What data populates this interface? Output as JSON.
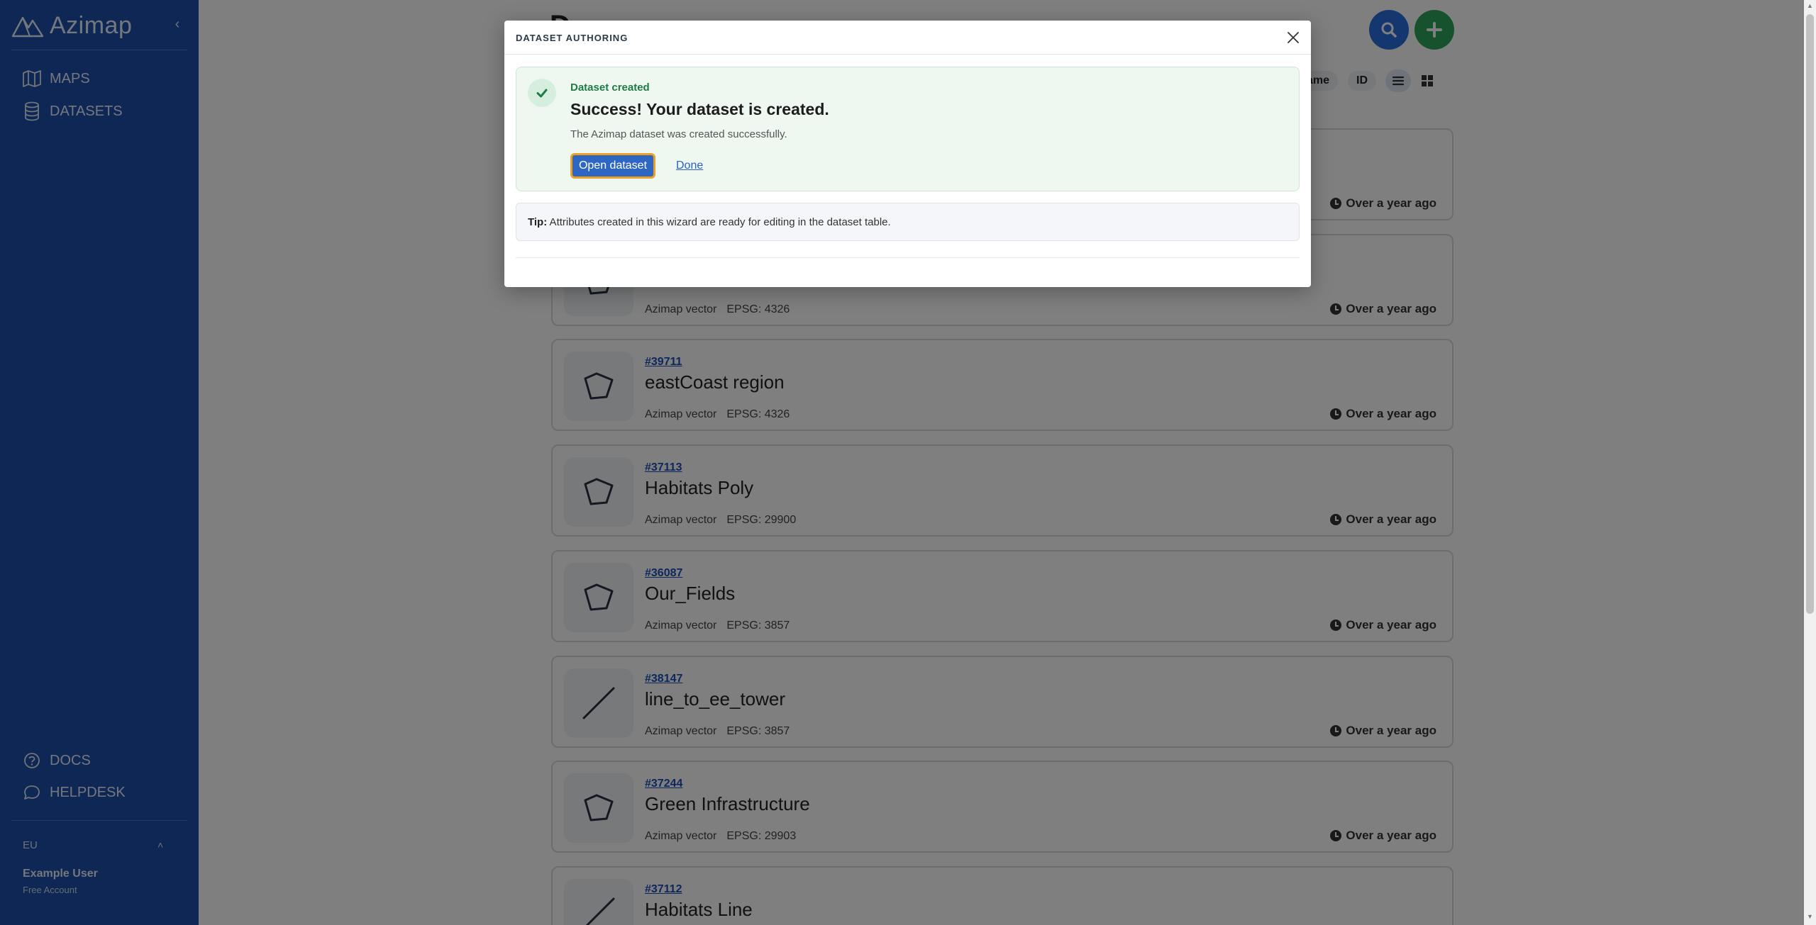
{
  "sidebar": {
    "brand": "Azimap",
    "nav": [
      {
        "label": "MAPS",
        "icon": "map-icon"
      },
      {
        "label": "DATASETS",
        "icon": "database-icon"
      }
    ],
    "bottom_nav": [
      {
        "label": "DOCS",
        "icon": "help-circle-icon"
      },
      {
        "label": "HELPDESK",
        "icon": "chat-bubble-icon"
      }
    ],
    "region": "EU",
    "user_name": "Example User",
    "user_plan": "Free Account"
  },
  "main": {
    "page_title": "D",
    "sort_name_label": "ame",
    "sort_id_label": "ID",
    "datasets": [
      {
        "id": "",
        "name": "",
        "type": "",
        "epsg": "",
        "age": "Over a year ago",
        "geometry": "polygon"
      },
      {
        "id": "",
        "name": "",
        "type": "Azimap vector",
        "epsg": "EPSG: 4326",
        "age": "Over a year ago",
        "geometry": "polygon"
      },
      {
        "id": "#39711",
        "name": "eastCoast region",
        "type": "Azimap vector",
        "epsg": "EPSG: 4326",
        "age": "Over a year ago",
        "geometry": "polygon"
      },
      {
        "id": "#37113",
        "name": "Habitats Poly",
        "type": "Azimap vector",
        "epsg": "EPSG: 29900",
        "age": "Over a year ago",
        "geometry": "polygon"
      },
      {
        "id": "#36087",
        "name": "Our_Fields",
        "type": "Azimap vector",
        "epsg": "EPSG: 3857",
        "age": "Over a year ago",
        "geometry": "polygon"
      },
      {
        "id": "#38147",
        "name": "line_to_ee_tower",
        "type": "Azimap vector",
        "epsg": "EPSG: 3857",
        "age": "Over a year ago",
        "geometry": "line"
      },
      {
        "id": "#37244",
        "name": "Green Infrastructure",
        "type": "Azimap vector",
        "epsg": "EPSG: 29903",
        "age": "Over a year ago",
        "geometry": "polygon"
      },
      {
        "id": "#37112",
        "name": "Habitats Line",
        "type": "",
        "epsg": "",
        "age": "",
        "geometry": "line"
      }
    ]
  },
  "modal": {
    "title": "DATASET AUTHORING",
    "kicker": "Dataset created",
    "heading": "Success! Your dataset is created.",
    "description": "The Azimap dataset was created successfully.",
    "open_button": "Open dataset",
    "done_link": "Done",
    "tip_label": "Tip:",
    "tip_text": " Attributes created in this wizard are ready for editing in the dataset table."
  },
  "colors": {
    "sidebar": "#1d4fa8",
    "primary_button": "#2d67c3",
    "focus_ring": "#f0a020",
    "success": "#1f7a45",
    "search_fab": "#2b6fe0",
    "add_fab": "#2aa55a"
  }
}
